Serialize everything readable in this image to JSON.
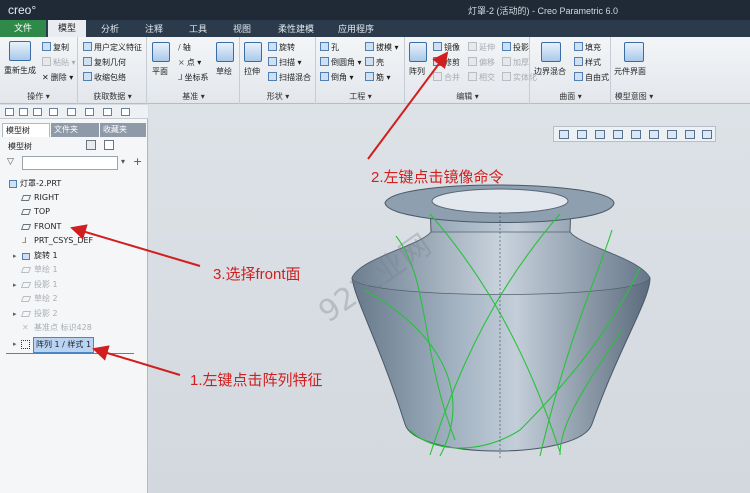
{
  "app": {
    "logo": "creo°",
    "title": "灯罩-2 (活动的) - Creo Parametric 6.0"
  },
  "tabs": [
    "文件",
    "模型",
    "分析",
    "注释",
    "工具",
    "视图",
    "柔性建模",
    "应用程序"
  ],
  "ribbon": {
    "operations": {
      "label": "操作",
      "regenerate": "重新生成",
      "copy": "复制",
      "paste": "粘贴",
      "delete": "删除"
    },
    "get_data": {
      "label": "获取数据",
      "udf": "用户定义特征",
      "copy_geom": "复制几何",
      "shrinkwrap": "收缩包络"
    },
    "datum": {
      "label": "基准",
      "plane": "平面",
      "axis": "轴",
      "point": "点",
      "csys": "坐标系",
      "sketch": "草绘"
    },
    "shapes": {
      "label": "形状",
      "extrude": "拉伸",
      "revolve": "旋转",
      "sweep": "扫描",
      "swept_blend": "扫描混合"
    },
    "engineering": {
      "label": "工程",
      "hole": "孔",
      "draft": "拔模",
      "round": "倒圆角",
      "shell": "壳",
      "chamfer": "倒角",
      "rib": "筋"
    },
    "editing": {
      "label": "编辑",
      "pattern": "阵列",
      "mirror": "镜像",
      "extend": "延伸",
      "project": "投影",
      "trim": "修剪",
      "offset": "偏移",
      "thicken": "加厚",
      "merge": "合并",
      "intersect": "相交",
      "solidify": "实体化"
    },
    "surfaces": {
      "label": "曲面",
      "boundary_blend": "边界混合",
      "fill": "填充",
      "style": "样式",
      "freestyle": "自由式"
    },
    "model_intent": {
      "label": "模型意图",
      "component_interface": "元件界面"
    }
  },
  "panel": {
    "tabs": [
      "模型树",
      "文件夹",
      "收藏夹"
    ],
    "tree_header": "模型树",
    "items": [
      {
        "label": "灯罩-2.PRT",
        "state": "normal"
      },
      {
        "label": "RIGHT",
        "state": "normal"
      },
      {
        "label": "TOP",
        "state": "normal"
      },
      {
        "label": "FRONT",
        "state": "normal"
      },
      {
        "label": "PRT_CSYS_DEF",
        "state": "normal"
      },
      {
        "label": "旋转 1",
        "state": "normal"
      },
      {
        "label": "草绘 1",
        "state": "disabled"
      },
      {
        "label": "投影 1",
        "state": "disabled"
      },
      {
        "label": "草绘 2",
        "state": "disabled"
      },
      {
        "label": "投影 2",
        "state": "disabled"
      },
      {
        "label": "基准点 标识428",
        "state": "disabled"
      },
      {
        "label": "阵列 1 / 样式 1",
        "state": "selected"
      }
    ]
  },
  "viewport": {
    "watermark": "92工业网"
  },
  "annotations": [
    "1.左键点击阵列特征",
    "2.左键点击镜像命令",
    "3.选择front面"
  ],
  "colors": {
    "annotation": "#d11f1f",
    "accent_green": "#2f8a4a",
    "curve_green": "#27c23a"
  }
}
